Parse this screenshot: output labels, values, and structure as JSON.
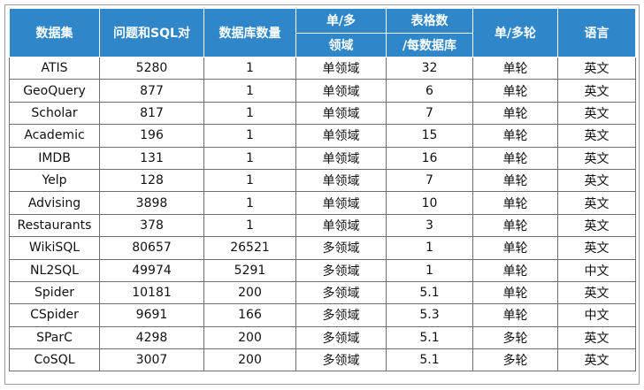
{
  "headers": {
    "dataset": "数据集",
    "pairs": "问题和SQL对",
    "db_count": "数据库数量",
    "domain_top": "单/多",
    "domain_bottom": "领域",
    "tables_top": "表格数",
    "tables_bottom": "/每数据库",
    "turns": "单/多轮",
    "language": "语言"
  },
  "rows": [
    [
      "ATIS",
      "5280",
      "1",
      "单领域",
      "32",
      "单轮",
      "英文"
    ],
    [
      "GeoQuery",
      "877",
      "1",
      "单领域",
      "6",
      "单轮",
      "英文"
    ],
    [
      "Scholar",
      "817",
      "1",
      "单领域",
      "7",
      "单轮",
      "英文"
    ],
    [
      "Academic",
      "196",
      "1",
      "单领域",
      "15",
      "单轮",
      "英文"
    ],
    [
      "IMDB",
      "131",
      "1",
      "单领域",
      "16",
      "单轮",
      "英文"
    ],
    [
      "Yelp",
      "128",
      "1",
      "单领域",
      "7",
      "单轮",
      "英文"
    ],
    [
      "Advising",
      "3898",
      "1",
      "单领域",
      "10",
      "单轮",
      "英文"
    ],
    [
      "Restaurants",
      "378",
      "1",
      "单领域",
      "3",
      "单轮",
      "英文"
    ],
    [
      "WikiSQL",
      "80657",
      "26521",
      "多领域",
      "1",
      "单轮",
      "英文"
    ],
    [
      "NL2SQL",
      "49974",
      "5291",
      "多领域",
      "1",
      "单轮",
      "中文"
    ],
    [
      "Spider",
      "10181",
      "200",
      "多领域",
      "5.1",
      "单轮",
      "英文"
    ],
    [
      "CSpider",
      "9691",
      "166",
      "多领域",
      "5.3",
      "单轮",
      "中文"
    ],
    [
      "SParC",
      "4298",
      "200",
      "多领域",
      "5.1",
      "多轮",
      "英文"
    ],
    [
      "CoSQL",
      "3007",
      "200",
      "多领域",
      "5.1",
      "多轮",
      "英文"
    ]
  ]
}
